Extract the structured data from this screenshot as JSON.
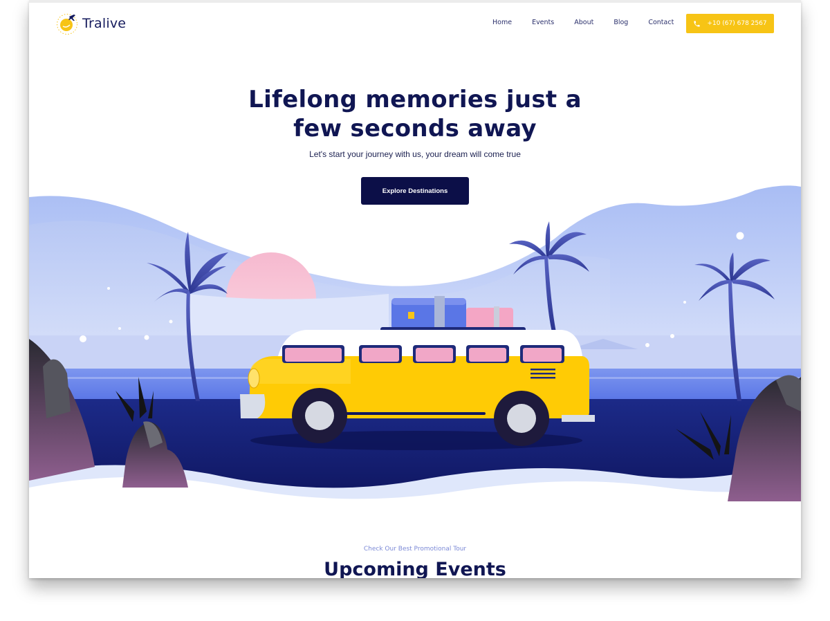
{
  "brand": {
    "name": "Tralive"
  },
  "nav": {
    "items": [
      "Home",
      "Events",
      "About",
      "Blog",
      "Contact"
    ]
  },
  "header": {
    "phone": "+10 (67) 678 2567"
  },
  "hero": {
    "title_line1": "Lifelong memories just a",
    "title_line2": "few seconds away",
    "subtitle": "Let's start your journey with us, your dream will come true",
    "cta_label": "Explore Destinations"
  },
  "events": {
    "eyebrow": "Check Our Best Promotional Tour",
    "title": "Upcoming Events"
  },
  "colors": {
    "accent": "#f7c415",
    "navy": "#101653",
    "cta": "#0c0f48"
  }
}
